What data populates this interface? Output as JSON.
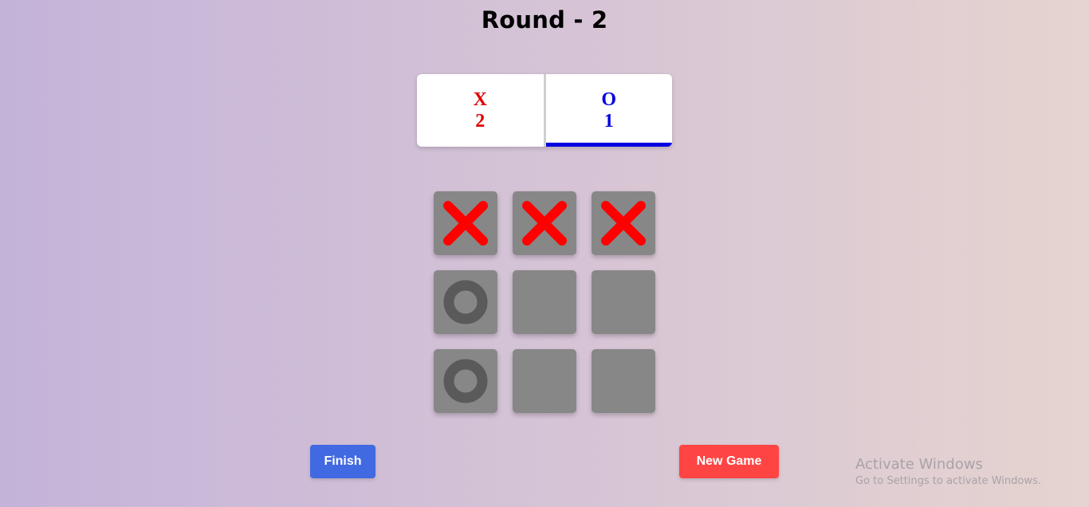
{
  "header": {
    "title": "Round - 2"
  },
  "scoreboard": {
    "players": [
      {
        "symbol": "X",
        "score": "2",
        "color": "#e00000"
      },
      {
        "symbol": "O",
        "score": "1",
        "color": "#0000e0"
      }
    ],
    "active_player": "O"
  },
  "board": {
    "cells": [
      "X",
      "X",
      "X",
      "O",
      "",
      "",
      "O",
      "",
      ""
    ],
    "x_color": "#ff0000",
    "o_color": "#5a5a5a",
    "cell_color": "#878787"
  },
  "buttons": {
    "finish_label": "Finish",
    "finish_color": "#4169e1",
    "new_game_label": "New Game",
    "new_game_color": "#ff4444"
  },
  "watermark": {
    "title": "Activate Windows",
    "subtitle": "Go to Settings to activate Windows."
  }
}
